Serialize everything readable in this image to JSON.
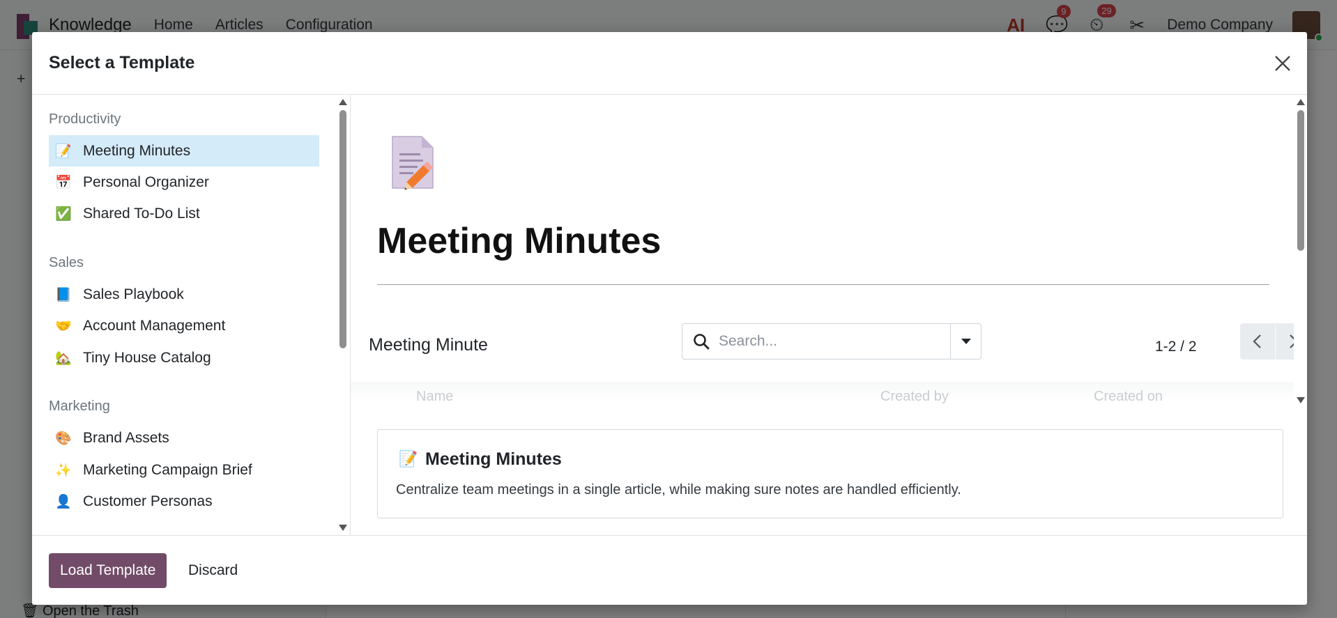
{
  "app": {
    "name": "Knowledge",
    "nav": [
      "Home",
      "Articles",
      "Configuration"
    ],
    "messages_badge": "9",
    "activities_badge": "29",
    "company": "Demo Company",
    "trash_label": "Open the Trash"
  },
  "modal": {
    "title": "Select a Template",
    "groups": [
      {
        "label": "Productivity",
        "items": [
          {
            "emoji": "📝",
            "label": "Meeting Minutes",
            "active": true
          },
          {
            "emoji": "📅",
            "label": "Personal Organizer"
          },
          {
            "emoji": "✅",
            "label": "Shared To-Do List"
          }
        ]
      },
      {
        "label": "Sales",
        "items": [
          {
            "emoji": "📘",
            "label": "Sales Playbook"
          },
          {
            "emoji": "🤝",
            "label": "Account Management"
          },
          {
            "emoji": "🏡",
            "label": "Tiny House Catalog"
          }
        ]
      },
      {
        "label": "Marketing",
        "items": [
          {
            "emoji": "🎨",
            "label": "Brand Assets"
          },
          {
            "emoji": "✨",
            "label": "Marketing Campaign Brief"
          },
          {
            "emoji": "👤",
            "label": "Customer Personas"
          }
        ]
      }
    ],
    "preview": {
      "title": "Meeting Minutes",
      "embed_title": "Meeting Minute",
      "search_placeholder": "Search...",
      "pager": "1-2 / 2",
      "ghost_columns": [
        "Name",
        "Created by",
        "Created on"
      ],
      "card": {
        "emoji": "📝",
        "title": "Meeting Minutes",
        "description": "Centralize team meetings in a single article, while making sure notes are handled efficiently."
      }
    },
    "footer": {
      "load_label": "Load Template",
      "discard_label": "Discard"
    }
  },
  "colors": {
    "primary": "#714b67",
    "active_item": "#d4ebf9"
  }
}
